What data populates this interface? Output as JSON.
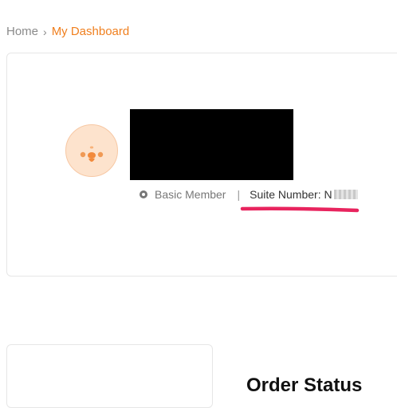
{
  "breadcrumb": {
    "home": "Home",
    "separator": "›",
    "current": "My Dashboard"
  },
  "profile": {
    "member_level": "Basic Member",
    "divider": "|",
    "suite_label": "Suite Number: N"
  },
  "sections": {
    "order_status_heading": "Order Status"
  },
  "colors": {
    "accent_orange": "#f07f1e",
    "highlight_pink": "#e8245e",
    "avatar_bg": "#fde3cd"
  },
  "icons": {
    "avatar": "chick-face-icon",
    "member_badge": "member-badge-icon"
  }
}
